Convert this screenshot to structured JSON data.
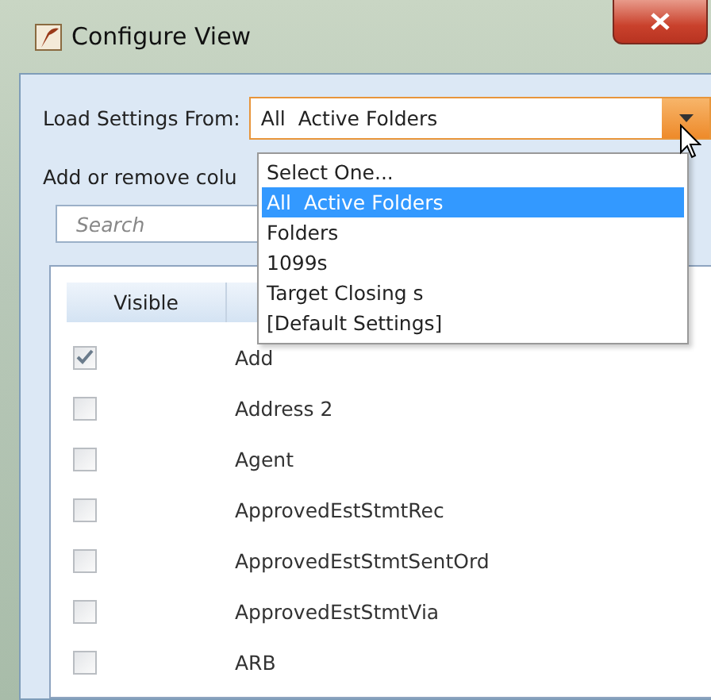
{
  "window": {
    "title": "Configure View"
  },
  "load_settings": {
    "label": "Load Settings From:",
    "value": "All  Active Folders",
    "expanded": true,
    "options": [
      {
        "label": "Select One...",
        "selected": false
      },
      {
        "label": "All  Active Folders",
        "selected": true
      },
      {
        "label": "Folders",
        "selected": false
      },
      {
        "label": "1099s",
        "selected": false
      },
      {
        "label": "Target Closing s",
        "selected": false
      },
      {
        "label": "[Default Settings]",
        "selected": false
      }
    ]
  },
  "columns_label": "Add or remove colu",
  "search": {
    "placeholder": "Search"
  },
  "table": {
    "columns": [
      "Visible"
    ],
    "rows": [
      {
        "name": "Add",
        "checked": true
      },
      {
        "name": "Address 2",
        "checked": false
      },
      {
        "name": "Agent",
        "checked": false
      },
      {
        "name": "ApprovedEstStmtRec",
        "checked": false
      },
      {
        "name": "ApprovedEstStmtSentOrd",
        "checked": false
      },
      {
        "name": "ApprovedEstStmtVia",
        "checked": false
      },
      {
        "name": "ARB",
        "checked": false
      }
    ]
  }
}
